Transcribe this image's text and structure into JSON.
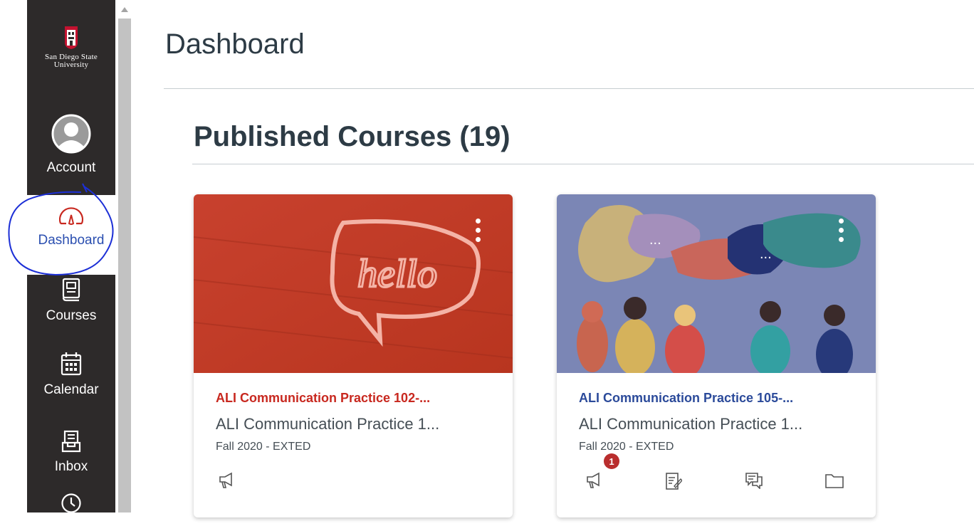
{
  "nav": {
    "logo_line1": "San Diego State",
    "logo_line2": "University",
    "items": [
      {
        "label": "Account",
        "icon": "user-icon"
      },
      {
        "label": "Dashboard",
        "icon": "dashboard-icon"
      },
      {
        "label": "Courses",
        "icon": "courses-icon"
      },
      {
        "label": "Calendar",
        "icon": "calendar-icon"
      },
      {
        "label": "Inbox",
        "icon": "inbox-icon"
      },
      {
        "label": "",
        "icon": "history-icon"
      }
    ]
  },
  "main": {
    "page_title": "Dashboard",
    "section_title": "Published Courses (19)"
  },
  "cards": [
    {
      "title": "ALI Communication Practice 102-...",
      "subtitle": "ALI Communication Practice 1...",
      "term": "Fall 2020 - EXTED",
      "title_color": "#c8281f",
      "icons": [
        "announcement-icon"
      ]
    },
    {
      "title": "ALI Communication Practice 105-...",
      "subtitle": "ALI Communication Practice 1...",
      "term": "Fall 2020 - EXTED",
      "title_color": "#2b4a9a",
      "announcement_badge": "1",
      "icons": [
        "announcement-icon",
        "assignment-icon",
        "discussion-icon",
        "files-icon"
      ]
    }
  ],
  "colors": {
    "nav_bg": "#2d2a2a",
    "active_link": "#2b4fb0",
    "dashboard_icon_red": "#c8281f"
  }
}
